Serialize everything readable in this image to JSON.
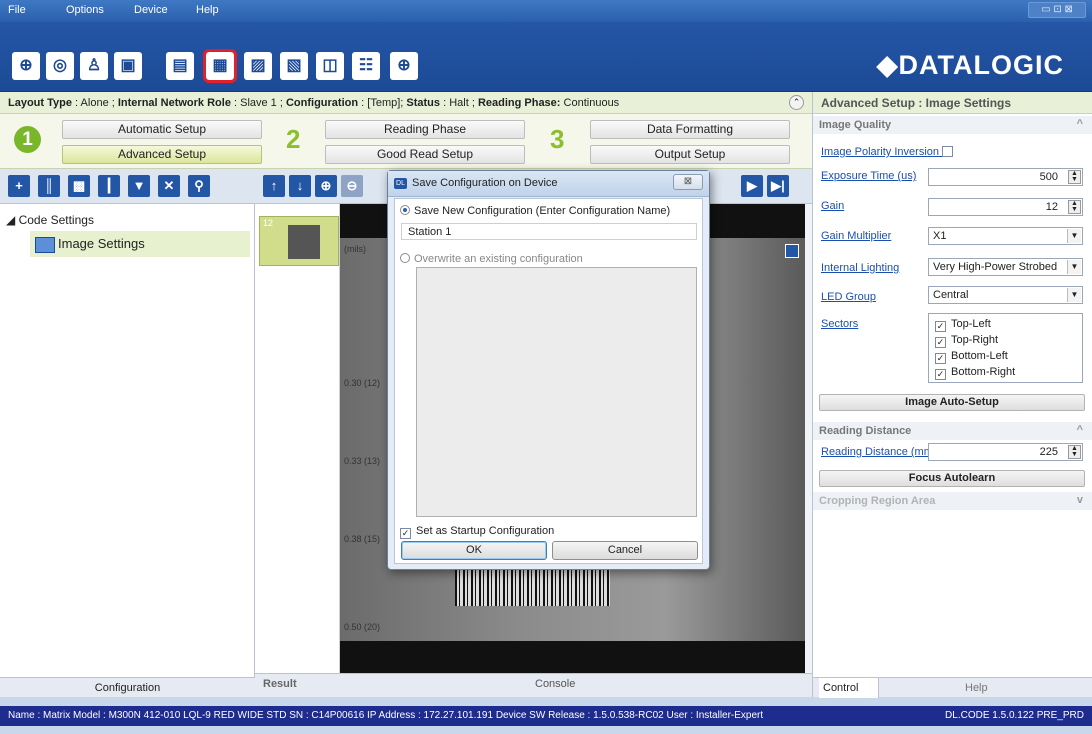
{
  "menu": {
    "file": "File",
    "options": "Options",
    "device": "Device",
    "help": "Help",
    "window_controls": "▭ ⊡ ⊠"
  },
  "brand": {
    "logo_text": "◆DATALOGIC"
  },
  "infobar": {
    "layout_type_label": "Layout Type",
    "layout_type_value": "Alone",
    "network_role_label": "Internal Network Role",
    "network_role_value": "Slave 1",
    "configuration_label": "Configuration",
    "configuration_value": "[Temp]",
    "status_label": "Status",
    "status_value": "Halt",
    "reading_phase_label": "Reading Phase:",
    "reading_phase_value": "Continuous"
  },
  "setup": {
    "step1": "1",
    "step2": "2",
    "step3": "3",
    "automatic_setup": "Automatic Setup",
    "advanced_setup": "Advanced Setup",
    "reading_phase": "Reading Phase",
    "good_read_setup": "Good Read Setup",
    "data_formatting": "Data Formatting",
    "output_setup": "Output Setup"
  },
  "left_panel": {
    "tree_root": "◢ Code Settings",
    "tree_item": "Image Settings",
    "footer_tab": "Configuration"
  },
  "center": {
    "thumb_number": "12",
    "ticks": [
      "(mils)",
      "0.30 (12)",
      "0.33 (13)",
      "0.38 (15)",
      "0.50 (20)"
    ],
    "result_tab": "Result",
    "console_tab": "Console"
  },
  "dialog": {
    "title": "Save Configuration on Device",
    "close": "⊠",
    "option_new": "Save New Configuration (Enter Configuration Name)",
    "name_value": "Station 1",
    "option_overwrite": "Overwrite an existing configuration",
    "startup_label": "Set as Startup Configuration",
    "ok": "OK",
    "cancel": "Cancel"
  },
  "right_panel": {
    "header": "Advanced Setup : Image Settings",
    "image_quality": "Image Quality",
    "image_polarity_inversion": "Image Polarity Inversion",
    "exposure_time_label": "Exposure Time (us)",
    "exposure_time_value": "500",
    "gain_label": "Gain",
    "gain_value": "12",
    "gain_multiplier_label": "Gain Multiplier",
    "gain_multiplier_value": "X1",
    "internal_lighting_label": "Internal Lighting",
    "internal_lighting_value": "Very High-Power Strobed",
    "led_group_label": "LED Group",
    "led_group_value": "Central",
    "sectors_label": "Sectors",
    "sectors": [
      "Top-Left",
      "Top-Right",
      "Bottom-Left",
      "Bottom-Right"
    ],
    "image_auto_setup": "Image Auto-Setup",
    "reading_distance_section": "Reading Distance",
    "reading_distance_label": "Reading Distance (mm)",
    "reading_distance_value": "225",
    "focus_autolearn": "Focus Autolearn",
    "cropping_region_area": "Cropping Region Area",
    "control_tab": "Control",
    "help_tab": "Help"
  },
  "statusbar": {
    "info": "Name : Matrix  Model : M300N 412-010 LQL-9 RED WIDE STD  SN : C14P00616  IP Address : 172.27.101.191  Device SW Release : 1.5.0.538-RC02  User : Installer-Expert",
    "version": "DL.CODE 1.5.0.122 PRE_PRD"
  },
  "colors": {
    "accent": "#2456a6",
    "highlight": "#e0202a",
    "step_green": "#7ab62a",
    "status_bg": "#1e2c8e"
  }
}
